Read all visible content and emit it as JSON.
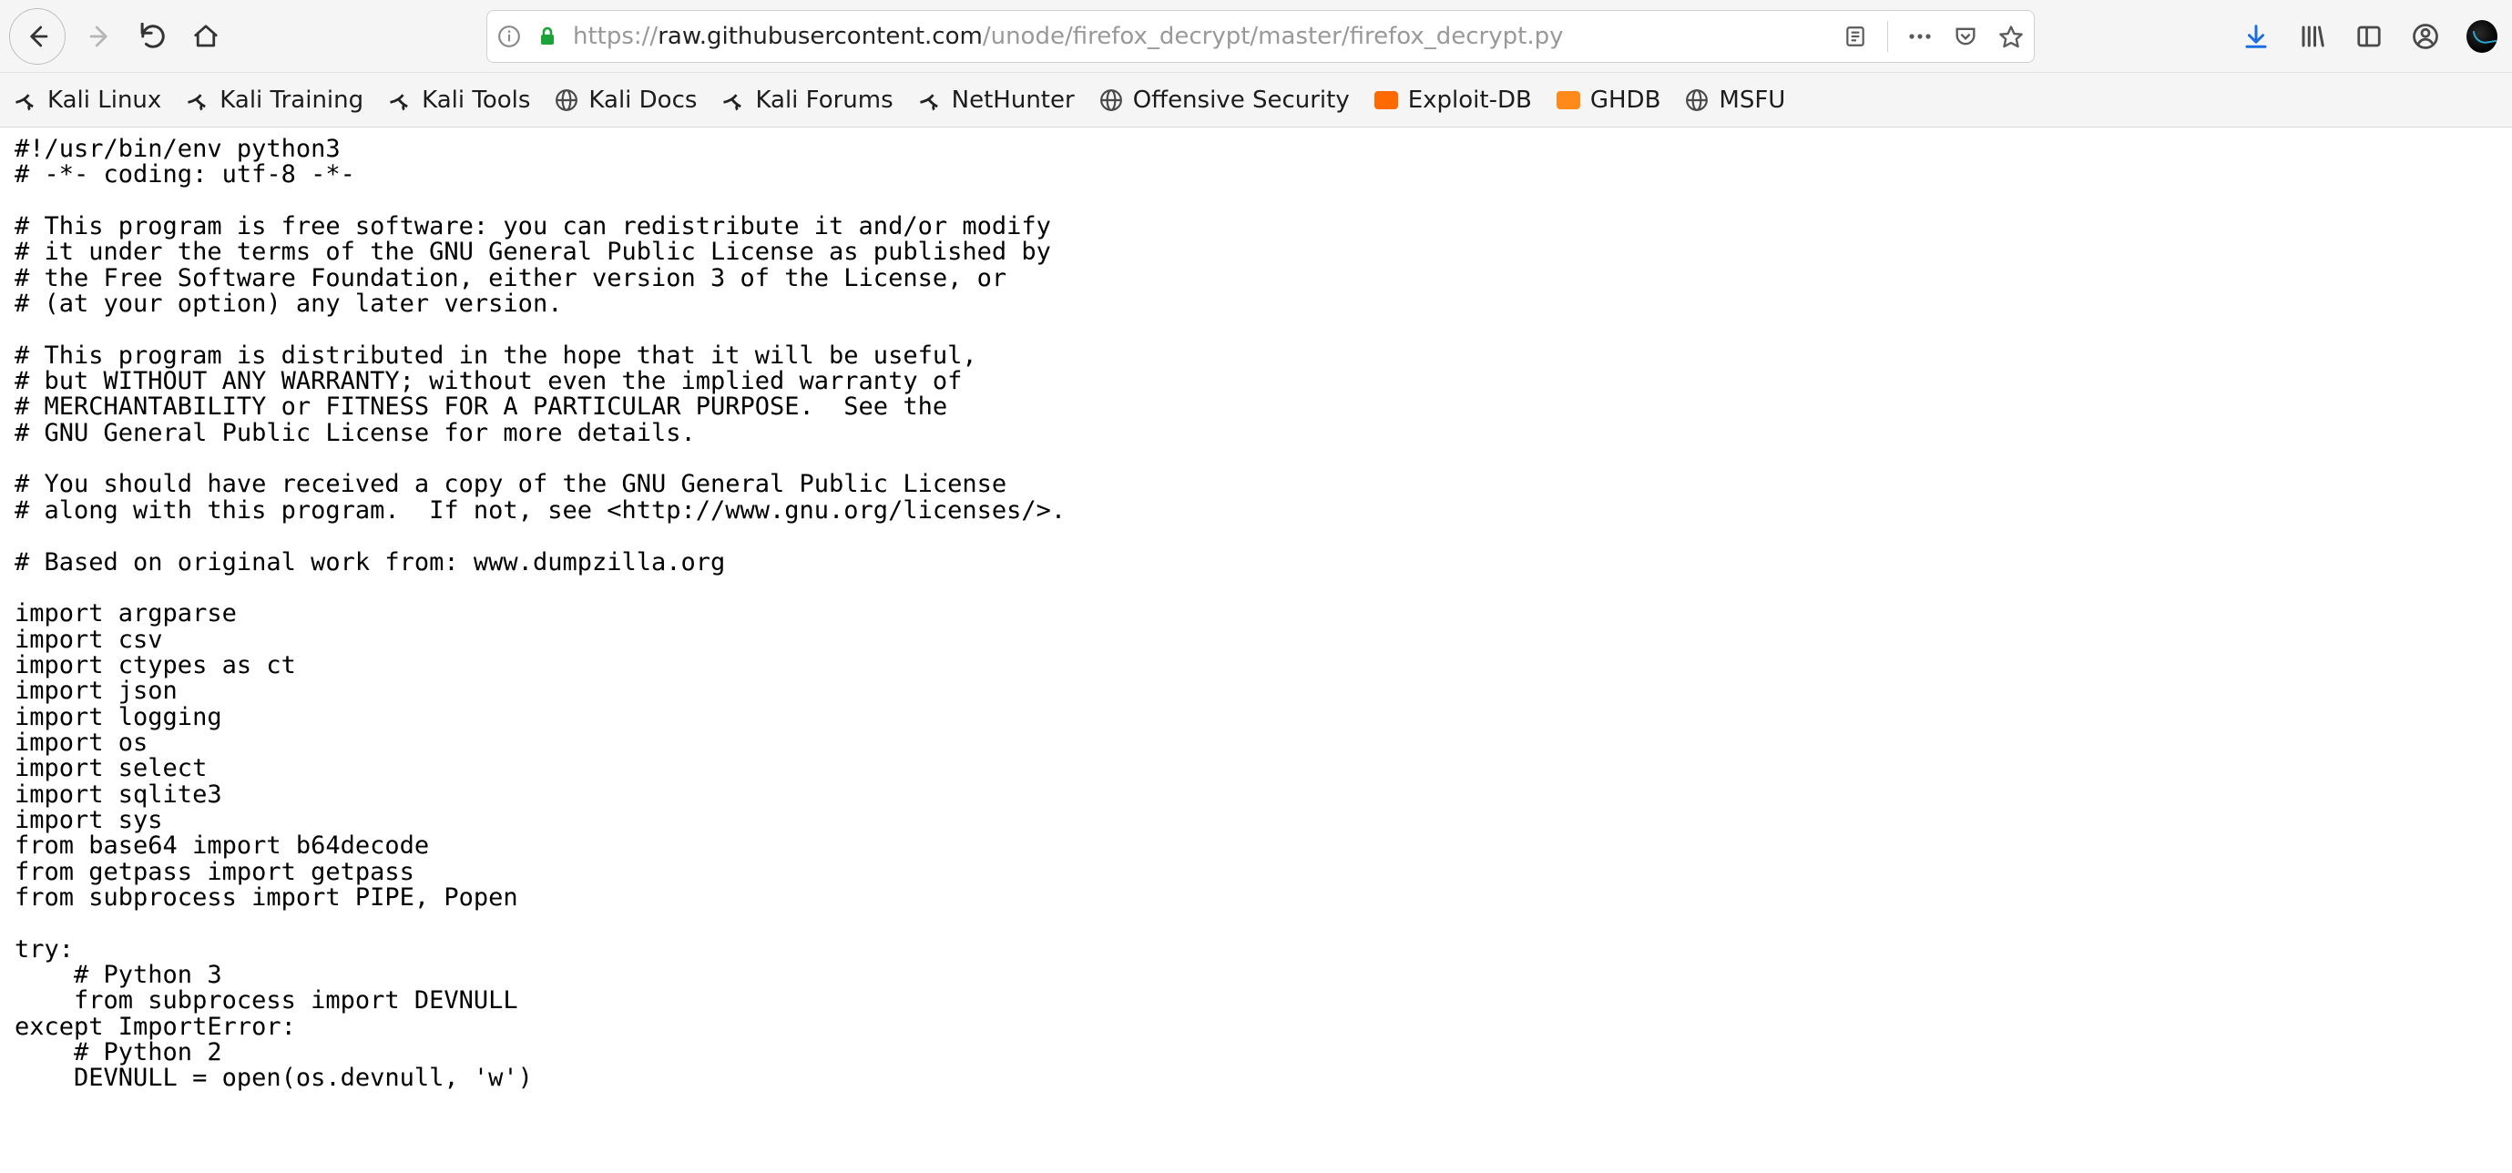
{
  "url": {
    "prefix": "https://",
    "host": "raw.githubusercontent.com",
    "path": "/unode/firefox_decrypt/master/firefox_decrypt.py"
  },
  "bookmarks": [
    {
      "label": "Kali Linux",
      "icon": "kali"
    },
    {
      "label": "Kali Training",
      "icon": "kali"
    },
    {
      "label": "Kali Tools",
      "icon": "kali"
    },
    {
      "label": "Kali Docs",
      "icon": "globe"
    },
    {
      "label": "Kali Forums",
      "icon": "kali"
    },
    {
      "label": "NetHunter",
      "icon": "kali"
    },
    {
      "label": "Offensive Security",
      "icon": "globe"
    },
    {
      "label": "Exploit-DB",
      "icon": "exploit"
    },
    {
      "label": "GHDB",
      "icon": "ghdb"
    },
    {
      "label": "MSFU",
      "icon": "globe"
    }
  ],
  "raw_text": "#!/usr/bin/env python3\n# -*- coding: utf-8 -*-\n\n# This program is free software: you can redistribute it and/or modify\n# it under the terms of the GNU General Public License as published by\n# the Free Software Foundation, either version 3 of the License, or\n# (at your option) any later version.\n\n# This program is distributed in the hope that it will be useful,\n# but WITHOUT ANY WARRANTY; without even the implied warranty of\n# MERCHANTABILITY or FITNESS FOR A PARTICULAR PURPOSE.  See the\n# GNU General Public License for more details.\n\n# You should have received a copy of the GNU General Public License\n# along with this program.  If not, see <http://www.gnu.org/licenses/>.\n\n# Based on original work from: www.dumpzilla.org\n\nimport argparse\nimport csv\nimport ctypes as ct\nimport json\nimport logging\nimport os\nimport select\nimport sqlite3\nimport sys\nfrom base64 import b64decode\nfrom getpass import getpass\nfrom subprocess import PIPE, Popen\n\ntry:\n    # Python 3\n    from subprocess import DEVNULL\nexcept ImportError:\n    # Python 2\n    DEVNULL = open(os.devnull, 'w')\n"
}
